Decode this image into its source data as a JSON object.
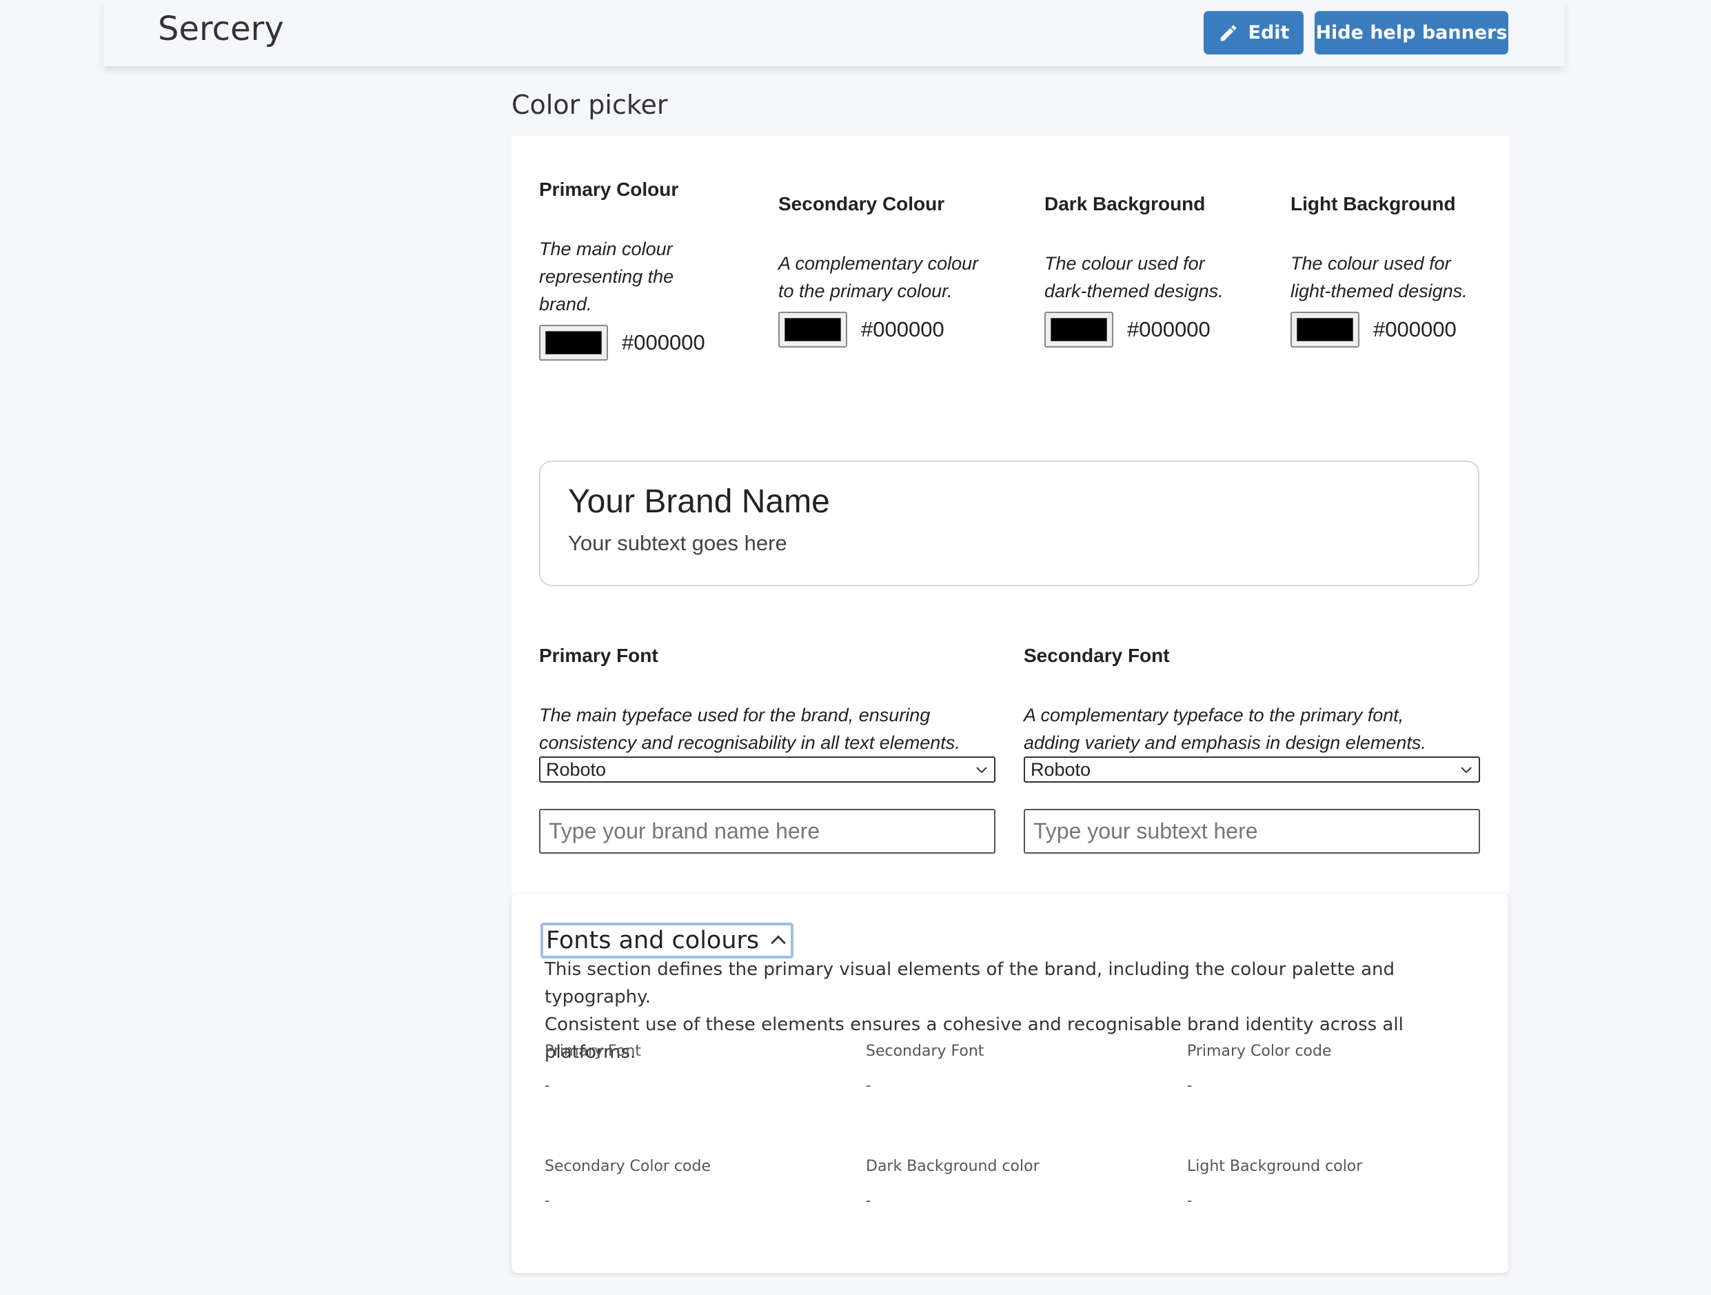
{
  "header": {
    "app_title": "Sercery",
    "edit_label": "Edit",
    "hide_banners_label": "Hide help banners"
  },
  "section": {
    "heading": "Color picker"
  },
  "colors": [
    {
      "title": "Primary Colour",
      "desc_lines": [
        "The main colour",
        "representing the",
        "brand."
      ],
      "hex": "#000000"
    },
    {
      "title": "Secondary Colour",
      "desc_lines": [
        "A complementary colour",
        "to the primary colour."
      ],
      "hex": "#000000"
    },
    {
      "title": "Dark Background",
      "desc_lines": [
        "The colour used for",
        "dark-themed designs."
      ],
      "hex": "#000000"
    },
    {
      "title": "Light Background",
      "desc_lines": [
        "The colour used for",
        "light-themed designs."
      ],
      "hex": "#000000"
    }
  ],
  "preview": {
    "brand_name": "Your Brand Name",
    "subtext": "Your subtext goes here"
  },
  "fonts": [
    {
      "title": "Primary Font",
      "desc_lines": [
        "The main typeface used for the brand, ensuring",
        "consistency and recognisability in all text elements."
      ],
      "selected": "Roboto",
      "input_placeholder": "Type your brand name here"
    },
    {
      "title": "Secondary Font",
      "desc_lines": [
        "A complementary typeface to the primary font,",
        "adding variety and emphasis in design elements."
      ],
      "selected": "Roboto",
      "input_placeholder": "Type your subtext here"
    }
  ],
  "summary": {
    "toggle_label": "Fonts and colours",
    "desc_lines": [
      "This section defines the primary visual elements of the brand, including the colour palette and typography.",
      "Consistent use of these elements ensures a cohesive and recognisable brand identity across all platforms."
    ],
    "fields": [
      {
        "label": "Primary Font",
        "value": "-"
      },
      {
        "label": "Secondary Font",
        "value": "-"
      },
      {
        "label": "Primary Color code",
        "value": "-"
      },
      {
        "label": "Secondary Color code",
        "value": "-"
      },
      {
        "label": "Dark Background color",
        "value": "-"
      },
      {
        "label": "Light Background color",
        "value": "-"
      }
    ]
  }
}
